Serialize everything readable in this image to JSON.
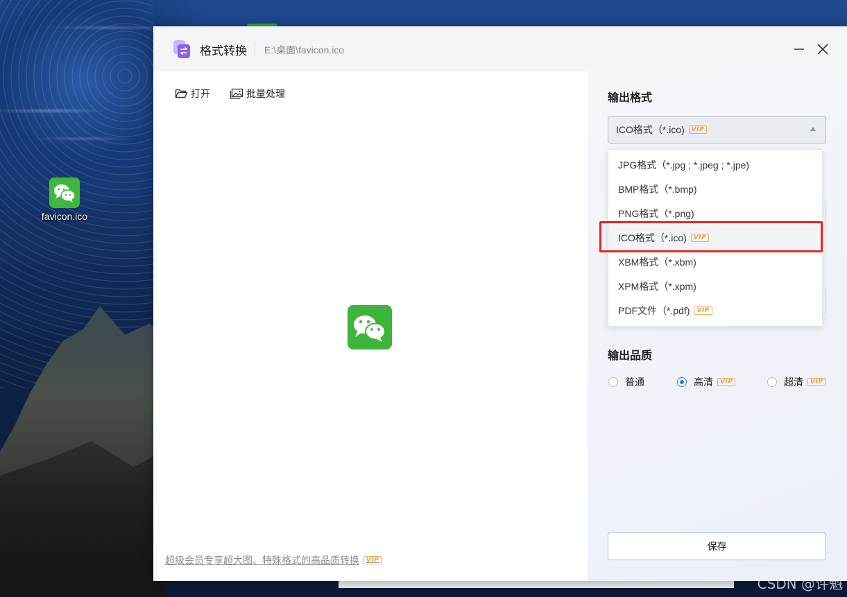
{
  "desktop": {
    "icon_label": "favicon.ico",
    "watermark": "CSDN @许魁"
  },
  "window": {
    "title": "格式转换",
    "file_path": "E:\\桌面\\favicon.ico"
  },
  "toolbar": {
    "open_label": "打开",
    "batch_label": "批量处理"
  },
  "promo": {
    "text": "超级会员专享超大图、特殊格式的高品质转换",
    "badge": "VIP"
  },
  "output_format": {
    "title": "输出格式",
    "selected_label": "ICO格式（*.ico)",
    "selected_badge": "VIP",
    "options": [
      {
        "label": "JPG格式（*.jpg ; *.jpeg ; *.jpe)",
        "badge": ""
      },
      {
        "label": "BMP格式（*.bmp)",
        "badge": ""
      },
      {
        "label": "PNG格式（*.png)",
        "badge": ""
      },
      {
        "label": "ICO格式（*.ico)",
        "badge": "VIP"
      },
      {
        "label": "XBM格式（*.xbm)",
        "badge": ""
      },
      {
        "label": "XPM格式（*.xpm)",
        "badge": ""
      },
      {
        "label": "PDF文件（*.pdf)",
        "badge": "VIP"
      }
    ]
  },
  "output_quality": {
    "title": "输出品质",
    "options": [
      {
        "label": "普通",
        "badge": "",
        "checked": false
      },
      {
        "label": "高清",
        "badge": "VIP",
        "checked": true
      },
      {
        "label": "超清",
        "badge": "VIP",
        "checked": false
      }
    ]
  },
  "save_label": "保存",
  "colors": {
    "accent": "#2a7de1",
    "wechat_green": "#3db43a",
    "vip_gold": "#e7a344",
    "highlight_red": "#e8231c"
  }
}
